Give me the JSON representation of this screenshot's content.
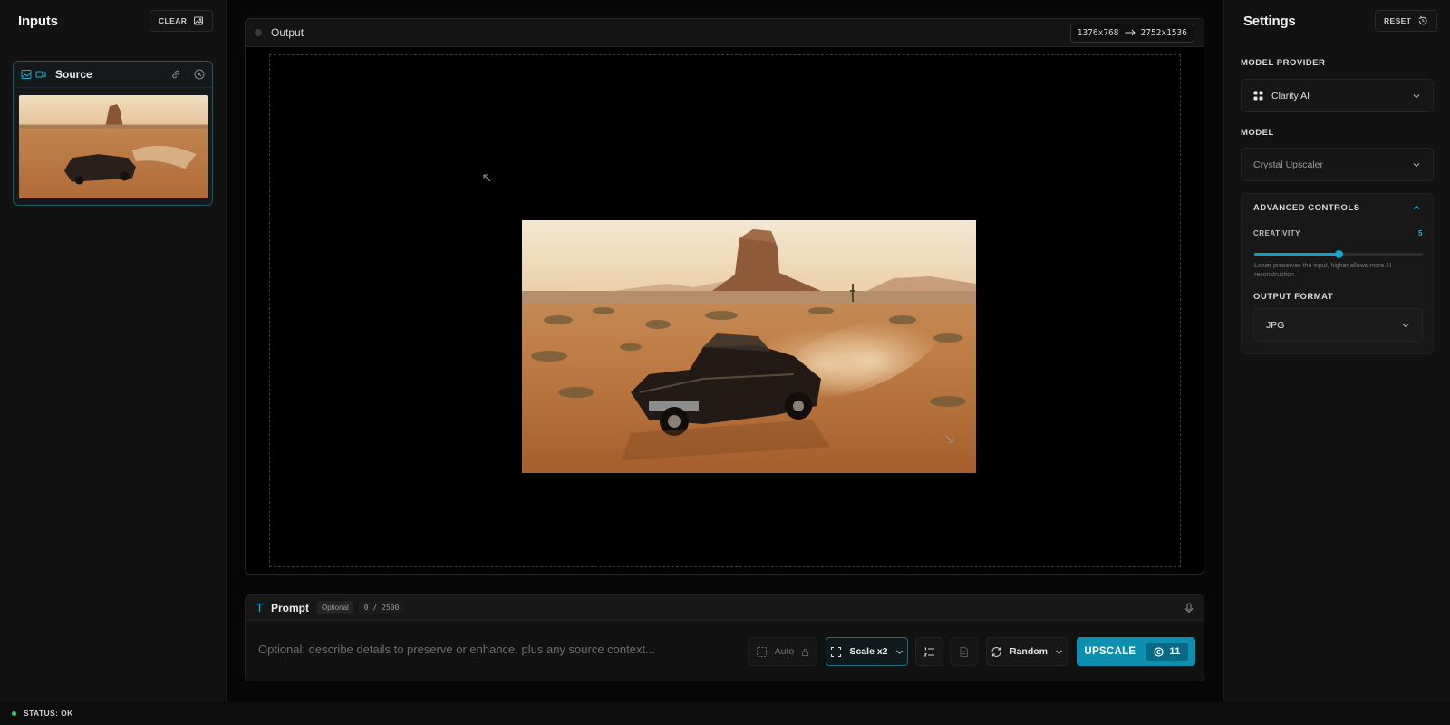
{
  "left": {
    "title": "Inputs",
    "clear_label": "CLEAR",
    "source_label": "Source"
  },
  "output": {
    "title": "Output",
    "res_from": "1376x768",
    "res_to": "2752x1536"
  },
  "prompt": {
    "label": "Prompt",
    "optional_badge": "Optional",
    "counter": "0 / 2500",
    "placeholder": "Optional: describe details to preserve or enhance, plus any source context...",
    "auto_label": "Auto",
    "scale_label": "Scale x2",
    "seed_label": "Random",
    "upscale_label": "UPSCALE",
    "cost": "11"
  },
  "settings": {
    "title": "Settings",
    "reset_label": "RESET",
    "model_provider_label": "MODEL PROVIDER",
    "model_provider_value": "Clarity AI",
    "model_label": "MODEL",
    "model_value": "Crystal Upscaler",
    "advanced_label": "ADVANCED CONTROLS",
    "creativity_label": "CREATIVITY",
    "creativity_value": "5",
    "creativity_fraction": 0.5,
    "creativity_hint": "Lower preserves the input, higher allows more AI reconstruction",
    "output_format_label": "OUTPUT FORMAT",
    "output_format_value": "JPG"
  },
  "status": {
    "text": "STATUS: OK"
  },
  "colors": {
    "accent": "#0d8fb0",
    "status_ok": "#2fd05a"
  }
}
